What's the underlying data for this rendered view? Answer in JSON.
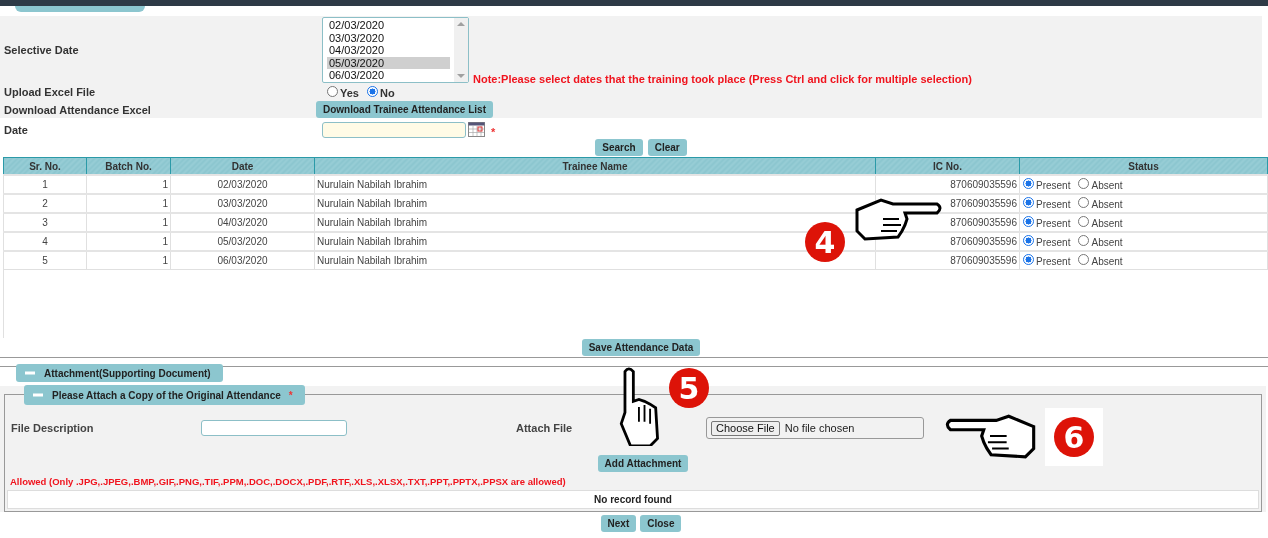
{
  "selective_date": {
    "label": "Selective Date",
    "options": [
      {
        "text": "02/03/2020",
        "selected": false
      },
      {
        "text": "03/03/2020",
        "selected": false
      },
      {
        "text": "04/03/2020",
        "selected": false
      },
      {
        "text": "05/03/2020",
        "selected": true
      },
      {
        "text": "06/03/2020",
        "selected": false
      }
    ],
    "note": "Note:Please select dates that the training took place (Press Ctrl and click for multiple selection)"
  },
  "upload_excel": {
    "label": "Upload Excel File",
    "options": [
      {
        "label": "Yes",
        "selected": false
      },
      {
        "label": "No",
        "selected": true
      }
    ]
  },
  "download": {
    "label": "Download Attendance Excel",
    "button": "Download Trainee Attendance List"
  },
  "date": {
    "label": "Date",
    "required_mark": "*"
  },
  "search_buttons": [
    "Search",
    "Clear"
  ],
  "table": {
    "columns": [
      "Sr. No.",
      "Batch No.",
      "Date",
      "Trainee Name",
      "IC No.",
      "Status"
    ],
    "rows": [
      {
        "sr": "1",
        "batch": "1",
        "date": "02/03/2020",
        "name": "Nurulain Nabilah Ibrahim",
        "ic": "870609035596",
        "status": [
          {
            "label": "Present",
            "selected": true
          },
          {
            "label": "Absent",
            "selected": false
          }
        ]
      },
      {
        "sr": "2",
        "batch": "1",
        "date": "03/03/2020",
        "name": "Nurulain Nabilah Ibrahim",
        "ic": "870609035596",
        "status": [
          {
            "label": "Present",
            "selected": true
          },
          {
            "label": "Absent",
            "selected": false
          }
        ]
      },
      {
        "sr": "3",
        "batch": "1",
        "date": "04/03/2020",
        "name": "Nurulain Nabilah Ibrahim",
        "ic": "870609035596",
        "status": [
          {
            "label": "Present",
            "selected": true
          },
          {
            "label": "Absent",
            "selected": false
          }
        ]
      },
      {
        "sr": "4",
        "batch": "1",
        "date": "05/03/2020",
        "name": "Nurulain Nabilah Ibrahim",
        "ic": "870609035596",
        "status": [
          {
            "label": "Present",
            "selected": true
          },
          {
            "label": "Absent",
            "selected": false
          }
        ]
      },
      {
        "sr": "5",
        "batch": "1",
        "date": "06/03/2020",
        "name": "Nurulain Nabilah Ibrahim",
        "ic": "870609035596",
        "status": [
          {
            "label": "Present",
            "selected": true
          },
          {
            "label": "Absent",
            "selected": false
          }
        ]
      }
    ]
  },
  "save_button": "Save Attendance Data",
  "attachment": {
    "title": "Attachment(Supporting Document)",
    "expanded": true,
    "subsection": {
      "title": "Please Attach a Copy of the Original Attendance",
      "required_mark": "*",
      "expanded": true
    },
    "file_description_label": "File Description",
    "attach_file_label": "Attach File",
    "file_button": "Choose File",
    "file_status": "No file chosen",
    "add_button": "Add Attachment",
    "allowed_note": "Allowed (Only .JPG,.JPEG,.BMP,.GIF,.PNG,.TIF,.PPM,.DOC,.DOCX,.PDF,.RTF,.XLS,.XLSX,.TXT,.PPT,.PPTX,.PPSX are allowed)",
    "empty_message": "No record found"
  },
  "footer_buttons": [
    "Next",
    "Close"
  ],
  "callouts": [
    "4",
    "5",
    "6"
  ]
}
